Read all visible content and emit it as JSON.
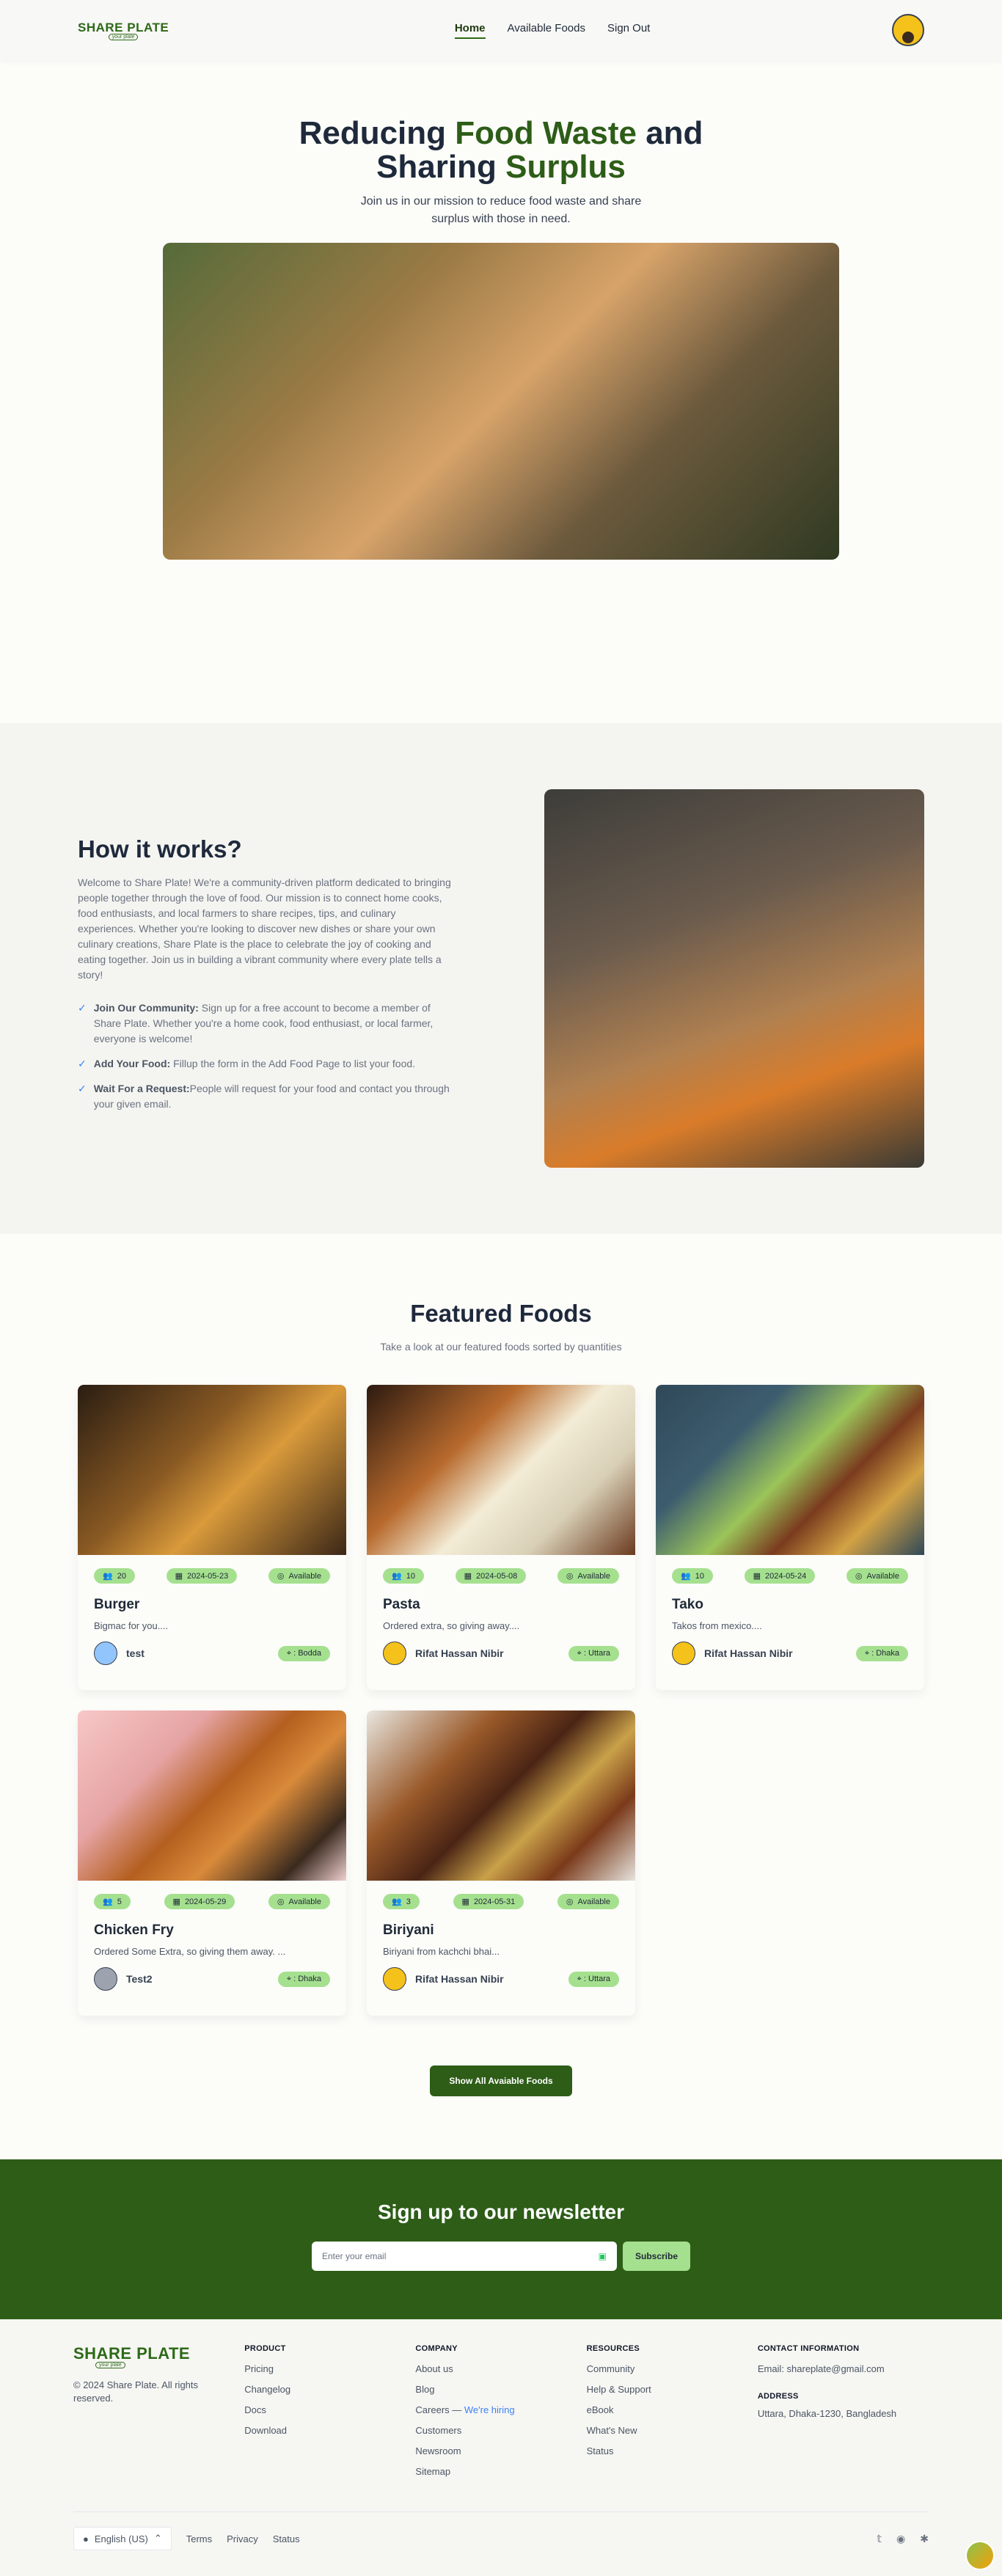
{
  "nav": {
    "logo": "SHARE PLATE",
    "logo_sub": "your plate",
    "links": [
      "Home",
      "Available Foods",
      "Sign Out"
    ]
  },
  "hero": {
    "title_a": "Reducing ",
    "title_b": "Food Waste",
    "title_c": " and",
    "title_d": "Sharing ",
    "title_e": "Surplus",
    "subtitle": "Join us in our mission to reduce food waste and share surplus with those in need."
  },
  "how": {
    "title": "How it works?",
    "intro": "Welcome to Share Plate! We're a community-driven platform dedicated to bringing people together through the love of food. Our mission is to connect home cooks, food enthusiasts, and local farmers to share recipes, tips, and culinary experiences. Whether you're looking to discover new dishes or share your own culinary creations, Share Plate is the place to celebrate the joy of cooking and eating together. Join us in building a vibrant community where every plate tells a story!",
    "items": [
      {
        "bold": "Join Our Community:",
        "text": " Sign up for a free account to become a member of Share Plate. Whether you're a home cook, food enthusiast, or local farmer, everyone is welcome!"
      },
      {
        "bold": "Add Your Food:",
        "text": " Fillup the form in the Add Food Page to list your food."
      },
      {
        "bold": "Wait For a Request:",
        "text": "People will request for your food and contact you through your given email."
      }
    ]
  },
  "featured": {
    "title": "Featured Foods",
    "subtitle": "Take a look at our featured foods sorted by quantities",
    "cards": [
      {
        "qty": "20",
        "date": "2024-05-23",
        "status": "Available",
        "name": "Burger",
        "desc": "Bigmac for you....",
        "donor": "test",
        "loc": ": Bodda"
      },
      {
        "qty": "10",
        "date": "2024-05-08",
        "status": "Available",
        "name": "Pasta",
        "desc": "Ordered extra, so giving away....",
        "donor": "Rifat Hassan Nibir",
        "loc": ": Uttara"
      },
      {
        "qty": "10",
        "date": "2024-05-24",
        "status": "Available",
        "name": "Tako",
        "desc": "Takos from mexico....",
        "donor": "Rifat Hassan Nibir",
        "loc": ": Dhaka"
      },
      {
        "qty": "5",
        "date": "2024-05-29",
        "status": "Available",
        "name": "Chicken Fry",
        "desc": "Ordered Some Extra, so giving them away. ...",
        "donor": "Test2",
        "loc": ": Dhaka"
      },
      {
        "qty": "3",
        "date": "2024-05-31",
        "status": "Available",
        "name": "Biriyani",
        "desc": "Biriyani from kachchi bhai...",
        "donor": "Rifat Hassan Nibir",
        "loc": ": Uttara"
      }
    ],
    "button": "Show All Avaiable Foods"
  },
  "newsletter": {
    "title": "Sign up to our newsletter",
    "placeholder": "Enter your email",
    "button": "Subscribe"
  },
  "footer": {
    "copyright": "© 2024 Share Plate. All rights reserved.",
    "product": {
      "title": "PRODUCT",
      "links": [
        "Pricing",
        "Changelog",
        "Docs",
        "Download"
      ]
    },
    "company": {
      "title": "COMPANY",
      "links": [
        "About us",
        "Blog",
        "Careers — ",
        "Customers",
        "Newsroom",
        "Sitemap"
      ],
      "hiring": "We're hiring"
    },
    "resources": {
      "title": "RESOURCES",
      "links": [
        "Community",
        "Help & Support",
        "eBook",
        "What's New",
        "Status"
      ]
    },
    "contact": {
      "title": "CONTACT INFORMATION",
      "email": "Email: shareplate@gmail.com",
      "address_title": "ADDRESS",
      "address": "Uttara, Dhaka-1230, Bangladesh"
    },
    "language": "English (US)",
    "bottom_links": [
      "Terms",
      "Privacy",
      "Status"
    ]
  },
  "colors": {
    "brand": "#2d5d17",
    "accent": "#a5e08f"
  }
}
